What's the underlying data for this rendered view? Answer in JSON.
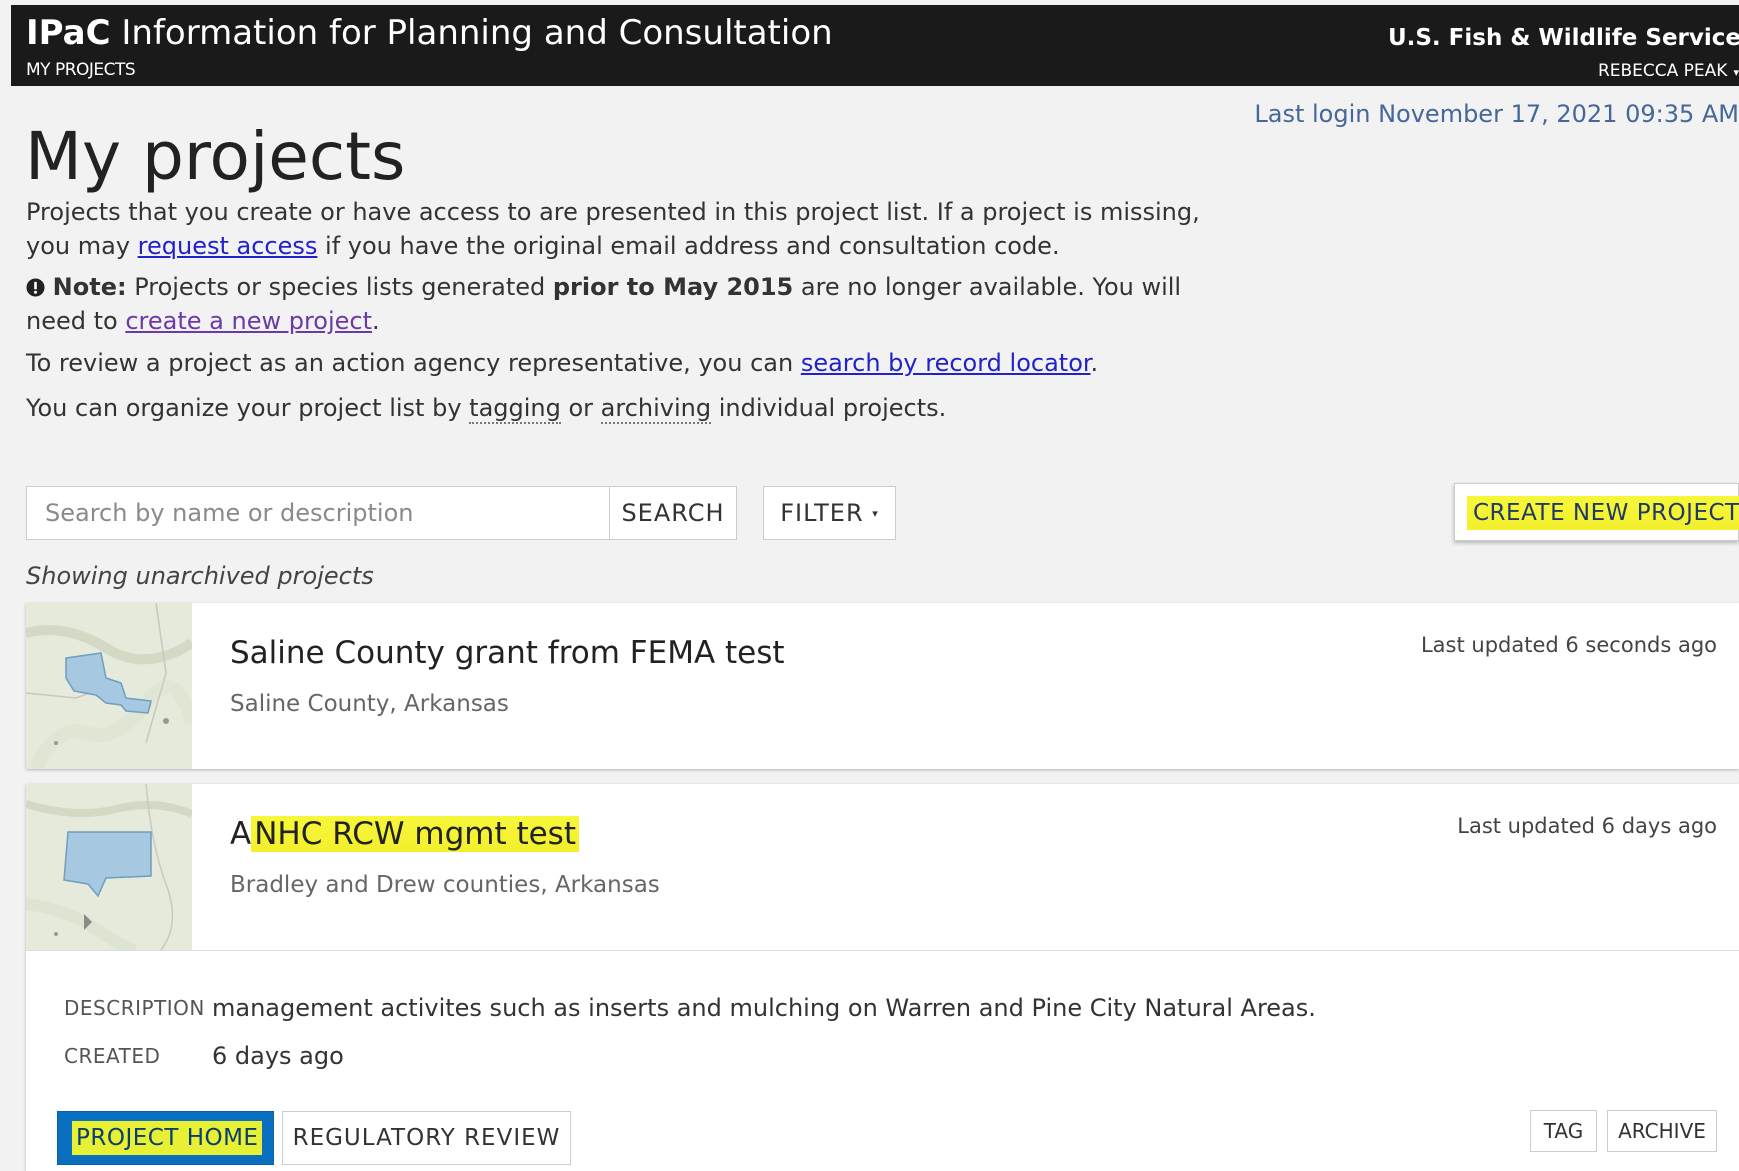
{
  "header": {
    "brand_short": "IPaC",
    "brand_full": "Information for Planning and Consultation",
    "nav_label": "MY PROJECTS",
    "agency": "U.S. Fish & Wildlife Service",
    "user_name": "REBECCA PEAK"
  },
  "page": {
    "last_login": "Last login November 17, 2021 09:35 AM",
    "title": "My projects"
  },
  "intro": {
    "p1_before": "Projects that you create or have access to are presented in this project list. If a project is missing, you may ",
    "p1_link": "request access",
    "p1_after": " if you have the original email address and consultation code.",
    "note_label": "Note:",
    "note_before": " Projects or species lists generated ",
    "note_bold": "prior to May 2015",
    "note_after": " are no longer available. You will need to ",
    "note_link": "create a new project",
    "note_end": ".",
    "p3_before": "To review a project as an action agency representative, you can ",
    "p3_link": "search by record locator",
    "p3_end": ".",
    "p4_before": "You can organize your project list by ",
    "p4_tagging": "tagging",
    "p4_mid": " or ",
    "p4_archiving": "archiving",
    "p4_after": " individual projects."
  },
  "toolbar": {
    "search_placeholder": "Search by name or description",
    "search_value": "",
    "search_label": "SEARCH",
    "filter_label": "FILTER",
    "create_label": "CREATE NEW PROJECT"
  },
  "list": {
    "showing": "Showing unarchived projects",
    "projects": [
      {
        "title": "Saline County grant from FEMA test",
        "location": "Saline County, Arkansas",
        "updated": "Last updated 6 seconds ago"
      },
      {
        "title_plain": "A",
        "title_highlight": "NHC RCW mgmt test",
        "location": "Bradley and Drew counties, Arkansas",
        "updated": "Last updated 6 days ago",
        "description_label": "DESCRIPTION",
        "description": "management activites such as inserts and mulching on Warren and Pine City Natural Areas.",
        "created_label": "CREATED",
        "created": "6 days ago",
        "actions": {
          "home": "PROJECT HOME",
          "review": "REGULATORY REVIEW",
          "tag": "TAG",
          "archive": "ARCHIVE"
        }
      }
    ]
  },
  "colors": {
    "header_bg": "#1a1a1a",
    "highlight": "#f2ef2c",
    "primary_button": "#0b6fbf",
    "link": "#2222cc",
    "visited_link": "#6b3aa8",
    "login_text": "#45679a"
  },
  "icons": {
    "note": "exclamation-circle-icon",
    "filter_caret": "caret-down-icon",
    "user_caret": "caret-down-icon"
  }
}
